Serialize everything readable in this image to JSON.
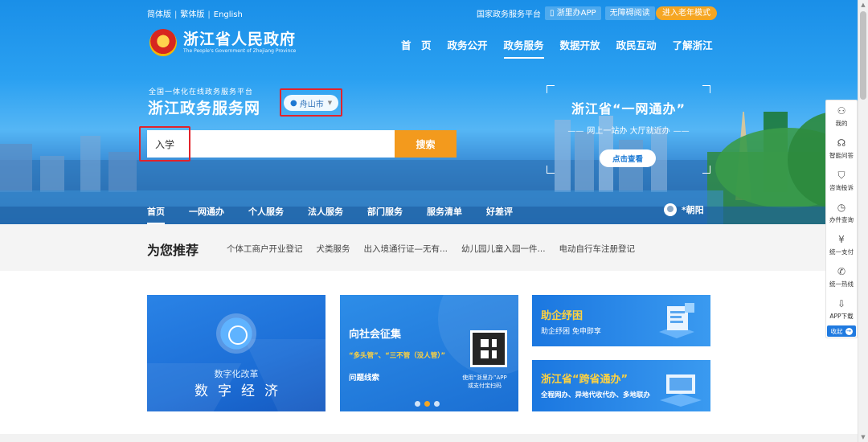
{
  "topbar": {
    "lang_simplified": "简体版",
    "lang_traditional": "繁体版",
    "lang_english": "English",
    "national_platform": "国家政务服务平台",
    "app_button": "浙里办APP",
    "accessibility": "无障碍阅读",
    "elder_mode": "进入老年模式"
  },
  "logo": {
    "title": "浙江省人民政府",
    "subtitle": "The People's Government of Zhejiang Province"
  },
  "main_nav": [
    "首　页",
    "政务公开",
    "政务服务",
    "数据开放",
    "政民互动",
    "了解浙江"
  ],
  "portal": {
    "subtitle": "全国一体化在线政务服务平台",
    "title": "浙江政务服务网",
    "city": "舟山市"
  },
  "search": {
    "value": "入学",
    "button": "搜索"
  },
  "promo": {
    "title": "浙江省“一网通办”",
    "slogan": "网上一站办 大厅就近办",
    "button": "点击查看"
  },
  "sub_nav": [
    "首页",
    "一网通办",
    "个人服务",
    "法人服务",
    "部门服务",
    "服务清单",
    "好差评"
  ],
  "user": {
    "name": "*朝阳"
  },
  "recommend": {
    "heading": "为您推荐",
    "links": [
      "个体工商户开业登记",
      "犬类服务",
      "出入境通行证—无有...",
      "幼儿园儿童入园一件...",
      "电动自行车注册登记"
    ]
  },
  "cards": {
    "digital": {
      "sub": "数字化改革",
      "main": "数字经济"
    },
    "solicit": {
      "title": "向社会征集",
      "quote": "“多头管”、“三不管（没人管）”",
      "issue": "问题线索",
      "qr_text": "使用“浙里办”APP\n或支付宝扫码"
    },
    "enterprise": {
      "title": "助企纾困",
      "desc": "助企纾困 免申即享"
    },
    "cross": {
      "title": "浙江省“跨省通办”",
      "desc": "全程网办、异地代收代办、多地联办"
    }
  },
  "sidebar": {
    "items": [
      {
        "label": "我的",
        "icon": "person-icon"
      },
      {
        "label": "智能问答",
        "icon": "headset-icon"
      },
      {
        "label": "咨询投诉",
        "icon": "shield-icon"
      },
      {
        "label": "办件查询",
        "icon": "history-icon"
      },
      {
        "label": "统一支付",
        "icon": "yen-icon"
      },
      {
        "label": "统一热线",
        "icon": "phone-icon"
      },
      {
        "label": "APP下载",
        "icon": "download-icon"
      }
    ],
    "collapse": "收起"
  }
}
